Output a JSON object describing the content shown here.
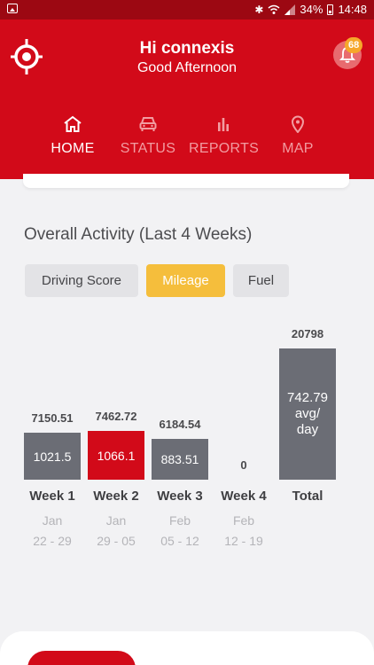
{
  "status_bar": {
    "battery": "34%",
    "time": "14:48",
    "icons": [
      "image-icon",
      "bluetooth-icon",
      "wifi-icon",
      "signal-icon",
      "battery-icon"
    ]
  },
  "header": {
    "greeting": "Hi connexis",
    "subgreeting": "Good Afternoon",
    "notification_count": "68",
    "brand_color": "#d20a19"
  },
  "nav": {
    "items": [
      {
        "label": "HOME",
        "icon": "home-icon",
        "active": true
      },
      {
        "label": "STATUS",
        "icon": "car-icon",
        "active": false
      },
      {
        "label": "REPORTS",
        "icon": "bar-chart-icon",
        "active": false
      },
      {
        "label": "MAP",
        "icon": "map-pin-icon",
        "active": false
      }
    ]
  },
  "activity": {
    "title": "Overall Activity (Last 4 Weeks)",
    "tabs": [
      {
        "label": "Driving Score",
        "active": false
      },
      {
        "label": "Mileage",
        "active": true
      },
      {
        "label": "Fuel",
        "active": false
      }
    ],
    "accent_color": "#f5be3c"
  },
  "chart_data": {
    "type": "bar",
    "categories": [
      "Week 1",
      "Week 2",
      "Week 3",
      "Week 4",
      "Total"
    ],
    "date_ranges": [
      {
        "month": "Jan",
        "range": "22 - 29"
      },
      {
        "month": "Jan",
        "range": "29 - 05"
      },
      {
        "month": "Feb",
        "range": "05 - 12"
      },
      {
        "month": "Feb",
        "range": "12 - 19"
      }
    ],
    "values": [
      7150.51,
      7462.72,
      6184.54,
      0,
      20798
    ],
    "value_labels": [
      "7150.51",
      "7462.72",
      "6184.54",
      "0",
      "20798"
    ],
    "inner_labels": [
      "1021.5",
      "1066.1",
      "883.51",
      "",
      "742.79 avg/ day"
    ],
    "highlight_index": 1,
    "colors": {
      "bar": "#6b6d75",
      "highlight": "#d20a19"
    }
  }
}
